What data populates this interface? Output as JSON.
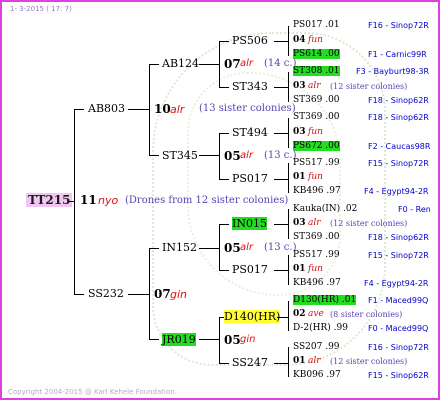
{
  "date": "1- 3-2015 ( 17: 7)",
  "copyright": "Copyright 2004-2015 @ Karl Kehele Foundation.",
  "root": {
    "id": "TT215",
    "num": "11",
    "race": "nyo",
    "info": "(Drones from 12 sister colonies)"
  },
  "l1": [
    {
      "id": "AB803",
      "num": "10",
      "race": "alr",
      "info": "(13 sister colonies)"
    },
    {
      "id": "SS232",
      "num": "07",
      "race": "gin"
    }
  ],
  "l2": [
    {
      "id": "AB124",
      "num": "07",
      "race": "alr",
      "info": "(14 c.)"
    },
    {
      "id": "ST345",
      "num": "05",
      "race": "alr",
      "info": "(13 c.)"
    },
    {
      "id": "IN152",
      "num": "05",
      "race": "alr",
      "info": "(13 c.)"
    },
    {
      "id": "JR019",
      "num": "05",
      "race": "gin"
    }
  ],
  "l3": [
    "PS506",
    "ST343",
    "ST494",
    "PS017",
    "IN015",
    "PS017",
    "D140(HR)",
    "SS247"
  ],
  "l4": [
    {
      "id": "PS017 .01",
      "right": "F16 - Sinop72R"
    },
    {
      "num": "04",
      "race": "fun"
    },
    {
      "id": "PS614 .00",
      "right": "F1 - Carnic99R"
    },
    {
      "id": "ST308 .01",
      "right": "F3 - Bayburt98-3R"
    },
    {
      "num": "03",
      "race": "alr",
      "info": "(12 sister colonies)"
    },
    {
      "id": "ST369 .00",
      "right": "F18 - Sinop62R"
    },
    {
      "id": "ST369 .00",
      "right": "F18 - Sinop62R"
    },
    {
      "num": "03",
      "race": "fun"
    },
    {
      "id": "PS672 .00",
      "right": "F2 - Caucas98R"
    },
    {
      "id": "PS517 .99",
      "right": "F15 - Sinop72R"
    },
    {
      "num": "01",
      "race": "fun"
    },
    {
      "id": "KB496 .97",
      "right": "F4 - Egypt94-2R"
    },
    {
      "id": "Kauka(IN) .02",
      "right": "F0 - Ren"
    },
    {
      "num": "03",
      "race": "alr",
      "info": "(12 sister colonies)"
    },
    {
      "id": "ST369 .00",
      "right": "F18 - Sinop62R"
    },
    {
      "id": "PS517 .99",
      "right": "F15 - Sinop72R"
    },
    {
      "num": "01",
      "race": "fun"
    },
    {
      "id": "KB496 .97",
      "right": "F4 - Egypt94-2R"
    },
    {
      "id": "D130(HR) .01",
      "right": "F1 - Maced99Q"
    },
    {
      "num": "02",
      "race": "ave",
      "info": "(8 sister colonies)"
    },
    {
      "id": "D-2(HR) .99",
      "right": "F0 - Maced99Q"
    },
    {
      "id": "SS207 .99",
      "right": "F16 - Sinop72R"
    },
    {
      "num": "01",
      "race": "alr",
      "info": "(12 sister colonies)"
    },
    {
      "id": "KB096 .97",
      "right": "F15 - Sinop62R"
    }
  ],
  "colors": {
    "frame": "#e040e0",
    "highlight_green": "#22dd22",
    "highlight_yellow": "#ffff33",
    "race": "#e01010",
    "right_text": "#0000c8",
    "info": "#5a3fb0"
  }
}
